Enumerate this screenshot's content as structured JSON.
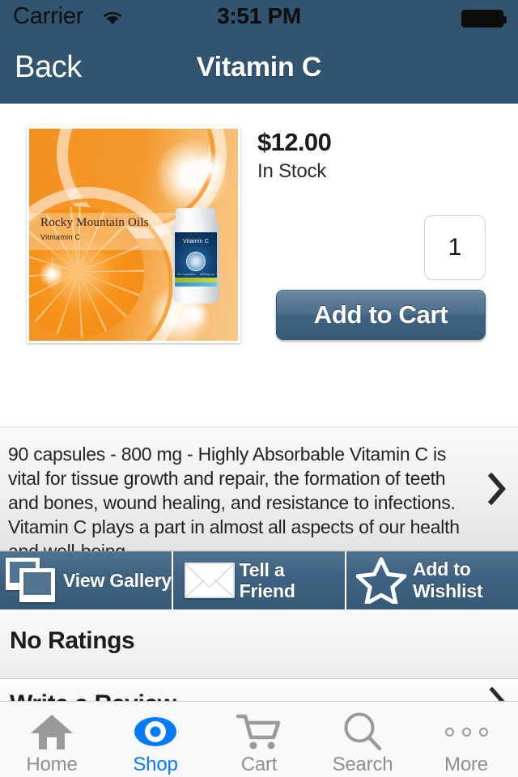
{
  "status_bar": {
    "carrier": "Carrier",
    "wifi_icon": "wifi-icon",
    "time": "3:51 PM",
    "battery_icon": "battery-full-icon"
  },
  "nav": {
    "back_label": "Back",
    "title": "Vitamin C"
  },
  "product": {
    "image": {
      "brand": "Rocky Mountain Oils",
      "brand_sub": "Vitmamin C",
      "bottle_label": "Vitamin C",
      "bottle_left_meta": "90 Capsules",
      "bottle_right_meta": "800mg ea"
    },
    "price": "$12.00",
    "availability": "In Stock",
    "quantity": "1",
    "add_to_cart_label": "Add to Cart",
    "description": "90 capsules - 800 mg - Highly Absorbable Vitamin C is vital for tissue growth and repair, the formation of teeth and bones, wound healing, and resistance to infections. Vitamin C plays a part in almost all aspects of our health and well-being."
  },
  "actions": [
    {
      "label": "View Gallery",
      "icon": "gallery-icon"
    },
    {
      "label": "Tell a Friend",
      "icon": "envelope-icon"
    },
    {
      "label": "Add to\nWishlist",
      "label_line1": "Add to",
      "label_line2": "Wishlist",
      "icon": "star-icon"
    }
  ],
  "ratings": {
    "summary": "No Ratings",
    "write_review_label": "Write a Review"
  },
  "tabs": [
    {
      "label": "Home",
      "icon": "home-icon",
      "active": false
    },
    {
      "label": "Shop",
      "icon": "eye-icon",
      "active": true
    },
    {
      "label": "Cart",
      "icon": "cart-icon",
      "active": false
    },
    {
      "label": "Search",
      "icon": "search-icon",
      "active": false
    },
    {
      "label": "More",
      "icon": "more-dots-icon",
      "active": false
    }
  ],
  "colors": {
    "header": "#31546F",
    "accent_blue": "#047AFF",
    "button": "#3F6482",
    "tab_inactive": "#8E8E93"
  }
}
